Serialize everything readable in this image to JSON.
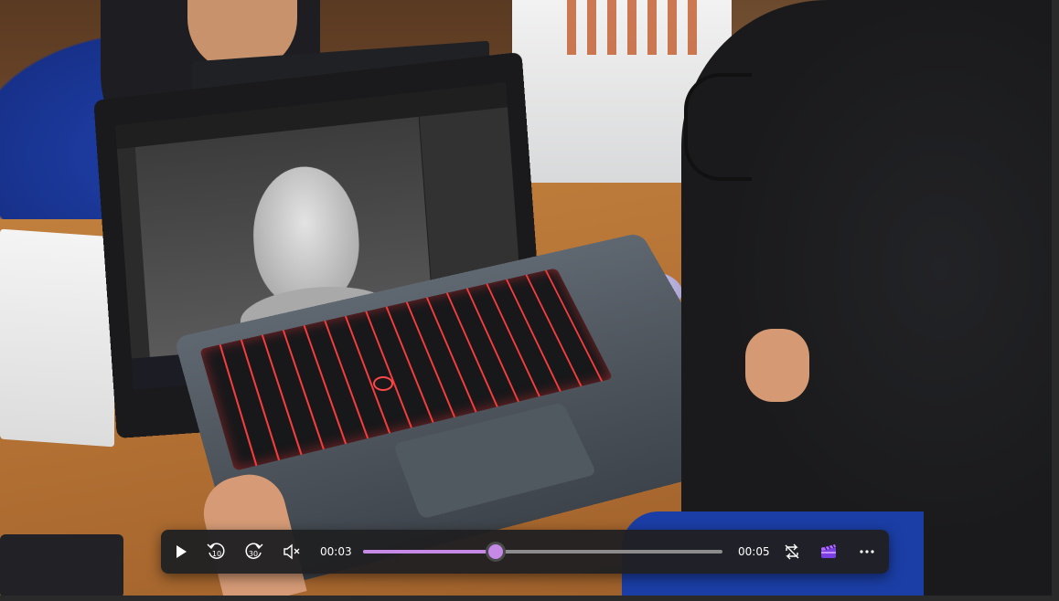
{
  "player": {
    "current_time": "00:03",
    "total_time": "00:05",
    "progress_fraction": 0.37,
    "accent_color": "#c789e6",
    "bar_color": "#202022",
    "buttons": {
      "play": "play-icon",
      "skip_back": "rewind-10-icon",
      "skip_back_label": "10",
      "skip_forward": "forward-30-icon",
      "skip_forward_label": "30",
      "mute": "volume-muted-icon",
      "repeat": "repeat-off-icon",
      "clipchamp": "clipchamp-icon",
      "more": "more-options-icon"
    }
  }
}
